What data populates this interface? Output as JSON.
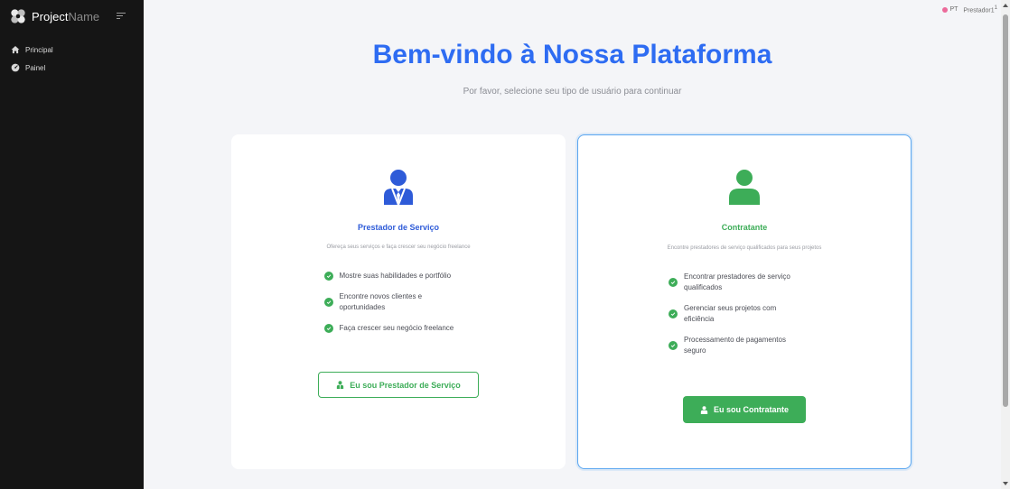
{
  "sidebar": {
    "brand": {
      "strong": "Project",
      "light": "Name"
    },
    "items": [
      {
        "label": "Principal",
        "icon": "home-icon"
      },
      {
        "label": "Painel",
        "icon": "dashboard-icon"
      }
    ]
  },
  "topbar": {
    "language": "PT",
    "user": "Prestador1",
    "user_sup": "1"
  },
  "main": {
    "title": "Bem-vindo à Nossa Plataforma",
    "subtitle": "Por favor, selecione seu tipo de usuário para continuar"
  },
  "cards": [
    {
      "title": "Prestador de Serviço",
      "description": "Ofereça seus serviços e faça crescer seu negócio freelance",
      "features": [
        "Mostre suas habilidades e portfólio",
        "Encontre novos clientes e oportunidades",
        "Faça crescer seu negócio freelance"
      ],
      "button": "Eu sou Prestador de Serviço",
      "accent": "#2e5bd8",
      "icon": "businessman-icon"
    },
    {
      "title": "Contratante",
      "description": "Encontre prestadores de serviço qualificados para seus projetos",
      "features": [
        "Encontrar prestadores de serviço qualificados",
        "Gerenciar seus projetos com eficiência",
        "Processamento de pagamentos seguro"
      ],
      "button": "Eu sou Contratante",
      "accent": "#3dad58",
      "icon": "user-icon"
    }
  ],
  "colors": {
    "primary": "#2e6cf2",
    "success": "#3dad58",
    "sidebar_bg": "#151515",
    "selected_border": "#5aa6f0"
  }
}
